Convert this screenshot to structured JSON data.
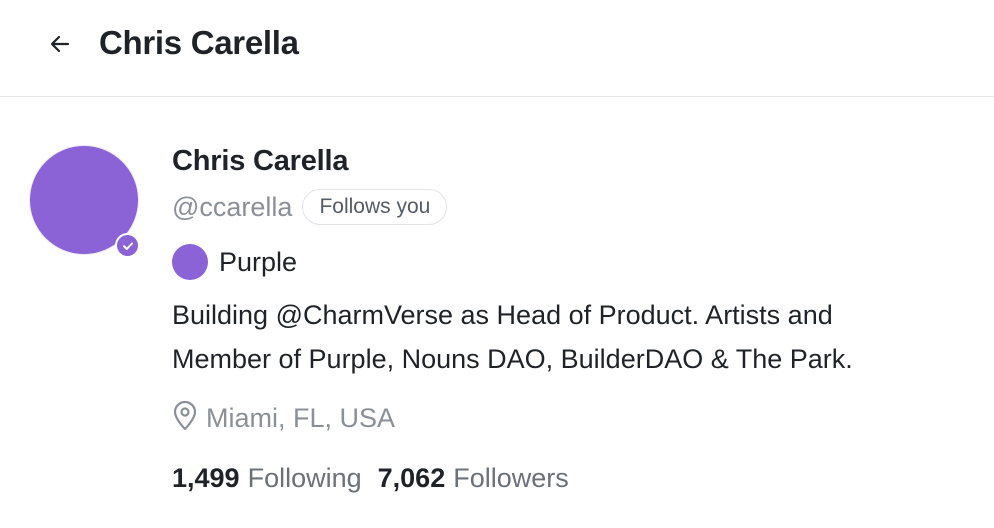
{
  "header": {
    "back_icon": "arrow-left-icon",
    "title": "Chris Carella"
  },
  "profile": {
    "avatar_color": "#8b63d6",
    "verified_icon": "check-badge-icon",
    "display_name": "Chris Carella",
    "handle": "@ccarella",
    "follows_you_badge": "Follows you",
    "channel": {
      "icon_color": "#8b63d6",
      "name": "Purple"
    },
    "bio_line1": "Building @CharmVerse as Head of Product. Artists and",
    "bio_line2": "Member of Purple, Nouns DAO, BuilderDAO & The Park.",
    "location_icon": "map-pin-icon",
    "location": "Miami, FL, USA",
    "following_count": "1,499",
    "following_label": "Following",
    "followers_count": "7,062",
    "followers_label": "Followers"
  }
}
